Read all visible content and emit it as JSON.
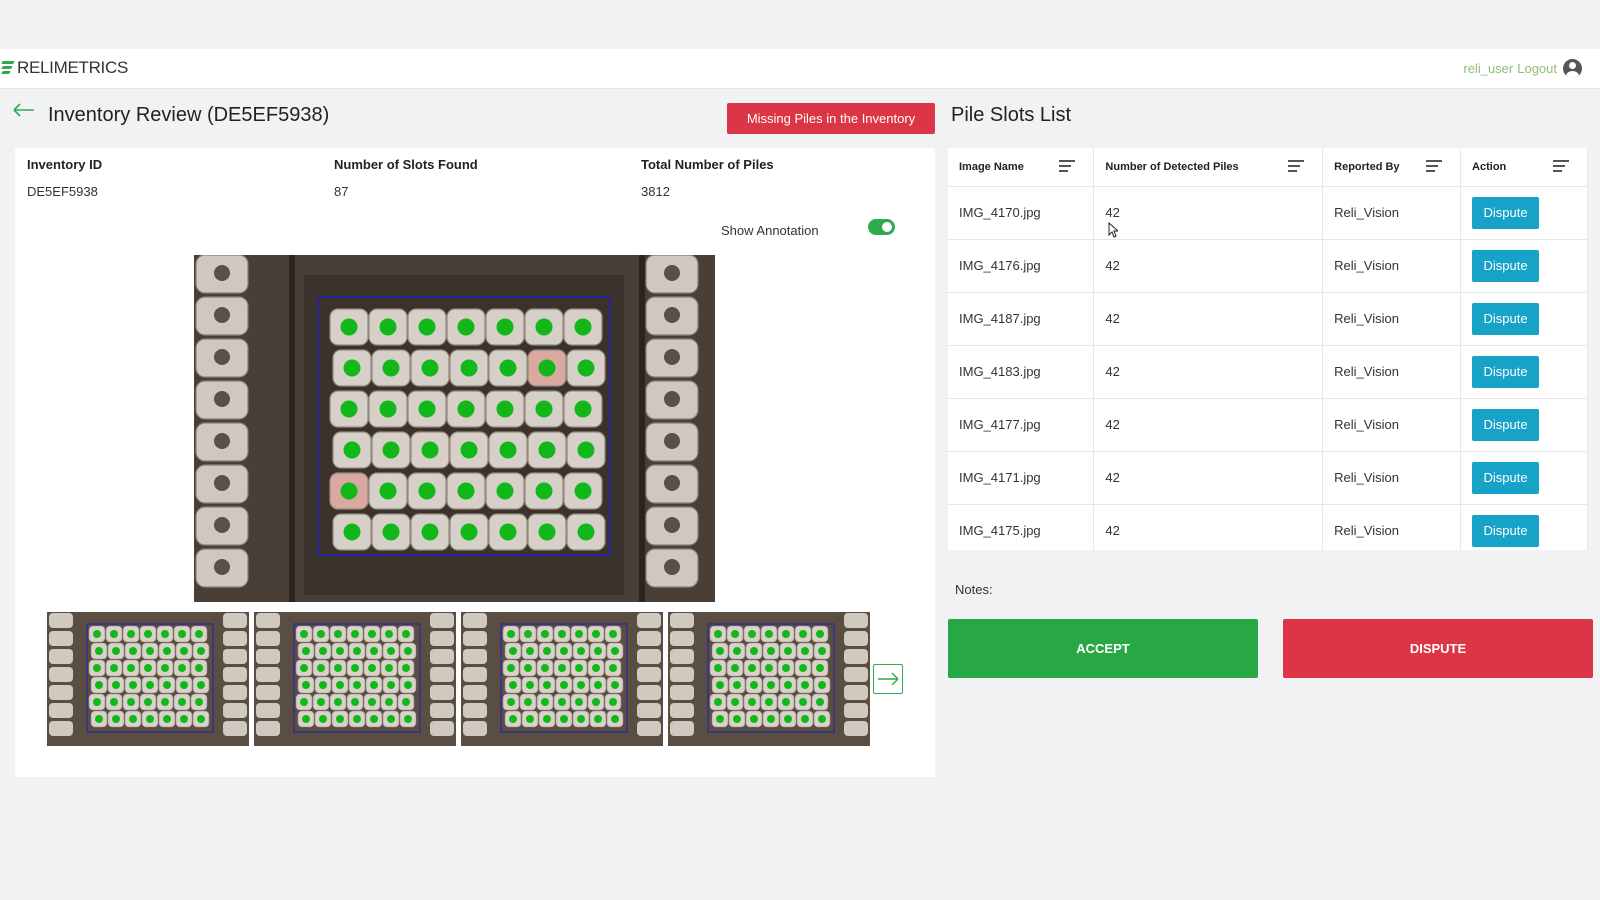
{
  "header": {
    "logo_text": "RELIMETRICS",
    "username": "reli_user",
    "logout_label": "Logout"
  },
  "page": {
    "title": "Inventory Review (DE5EF5938)",
    "missing_button": "Missing Piles in the Inventory"
  },
  "summary": {
    "inventory_id_label": "Inventory ID",
    "inventory_id_value": "DE5EF5938",
    "slots_label": "Number of Slots Found",
    "slots_value": "87",
    "piles_label": "Total Number of Piles",
    "piles_value": "3812"
  },
  "annotation": {
    "label": "Show Annotation",
    "enabled": true
  },
  "table": {
    "title": "Pile Slots List",
    "columns": [
      "Image Name",
      "Number of Detected Piles",
      "Reported By",
      "Action"
    ],
    "rows": [
      {
        "image": "IMG_4170.jpg",
        "count": "42",
        "reporter": "Reli_Vision",
        "action": "Dispute"
      },
      {
        "image": "IMG_4176.jpg",
        "count": "42",
        "reporter": "Reli_Vision",
        "action": "Dispute"
      },
      {
        "image": "IMG_4187.jpg",
        "count": "42",
        "reporter": "Reli_Vision",
        "action": "Dispute"
      },
      {
        "image": "IMG_4183.jpg",
        "count": "42",
        "reporter": "Reli_Vision",
        "action": "Dispute"
      },
      {
        "image": "IMG_4177.jpg",
        "count": "42",
        "reporter": "Reli_Vision",
        "action": "Dispute"
      },
      {
        "image": "IMG_4171.jpg",
        "count": "42",
        "reporter": "Reli_Vision",
        "action": "Dispute"
      },
      {
        "image": "IMG_4175.jpg",
        "count": "42",
        "reporter": "Reli_Vision",
        "action": "Dispute"
      }
    ]
  },
  "notes_label": "Notes:",
  "actions": {
    "accept": "ACCEPT",
    "dispute": "DISPUTE"
  },
  "icons": {
    "back": "back-arrow-icon",
    "user": "user-icon",
    "sort": "sort-icon",
    "next": "next-arrow-icon"
  },
  "colors": {
    "brand_green": "#2eaa4f",
    "danger_red": "#dc3545",
    "info_blue": "#17a2c8",
    "detection_dot": "#12b81a",
    "slot_box": "#1f1fb8"
  }
}
